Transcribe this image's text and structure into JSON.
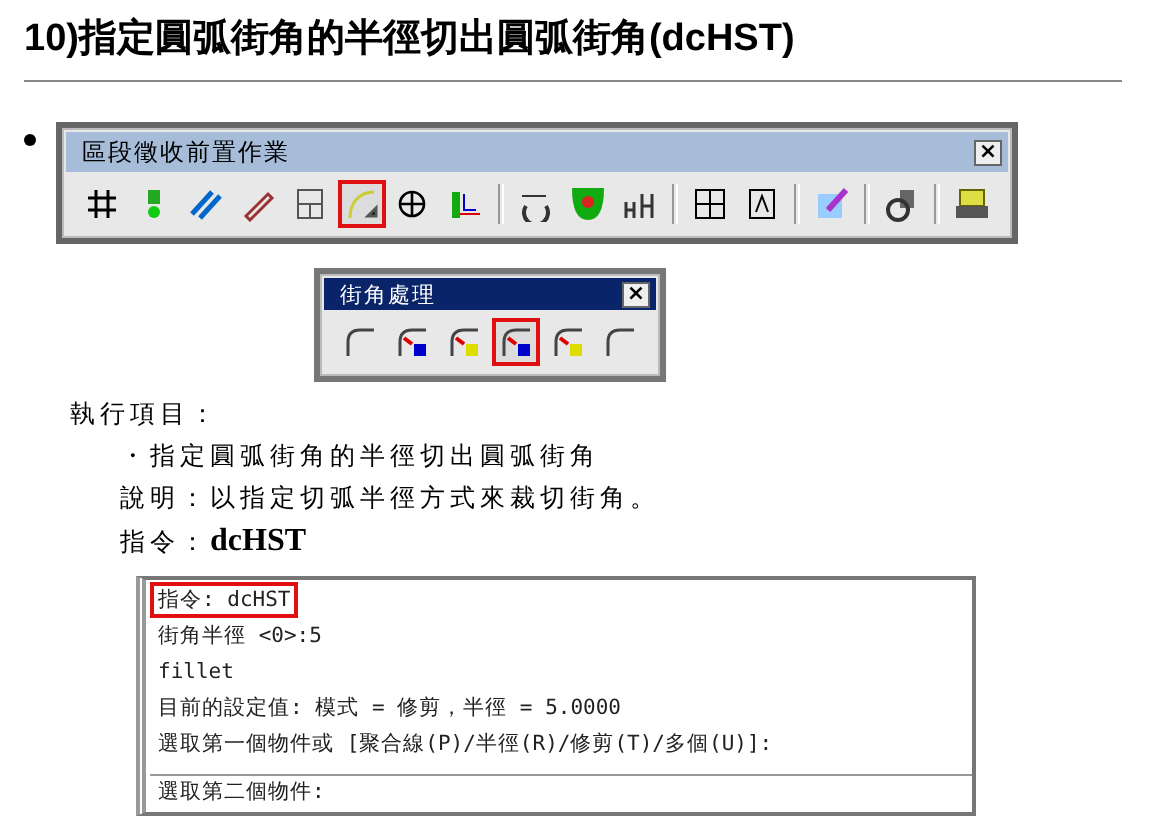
{
  "title": "10)指定圓弧街角的半徑切出圓弧街角(dcHST)",
  "toolbars": [
    {
      "title": "區段徵收前置作業",
      "close": "×",
      "groups": [
        [
          {
            "selected": false
          },
          {
            "selected": false
          },
          {
            "selected": false
          },
          {
            "selected": false
          },
          {
            "selected": false
          },
          {
            "selected": true
          },
          {
            "selected": false
          },
          {
            "selected": false
          }
        ],
        [
          {
            "selected": false
          },
          {
            "selected": false
          },
          {
            "selected": false
          }
        ],
        [
          {
            "selected": false
          },
          {
            "selected": false
          }
        ],
        [
          {
            "selected": false
          }
        ],
        [
          {
            "selected": false
          }
        ],
        [
          {
            "selected": false
          }
        ]
      ]
    },
    {
      "title": "街角處理",
      "close": "×",
      "groups": [
        [
          {
            "selected": false
          },
          {
            "selected": false
          },
          {
            "selected": false
          },
          {
            "selected": true
          },
          {
            "selected": false
          },
          {
            "selected": false
          }
        ]
      ]
    }
  ],
  "section_heading": "執行項目：",
  "bullet": "・指定圓弧街角的半徑切出圓弧街角",
  "description": "說明：以指定切弧半徑方式來裁切街角。",
  "command": {
    "label": "指令：",
    "value": "dcHST"
  },
  "command_window": {
    "lines": [
      {
        "text": "指令: dcHST",
        "highlighted": true
      },
      {
        "text": "街角半徑 <0>:5",
        "highlighted": false
      },
      {
        "text": "fillet",
        "highlighted": false
      },
      {
        "text": "目前的設定值: 模式 = 修剪，半徑 = 5.0000",
        "highlighted": false
      },
      {
        "text": "選取第一個物件或 [聚合線(P)/半徑(R)/修剪(T)/多個(U)]:",
        "highlighted": false
      }
    ],
    "prompt": "選取第二個物件:"
  }
}
